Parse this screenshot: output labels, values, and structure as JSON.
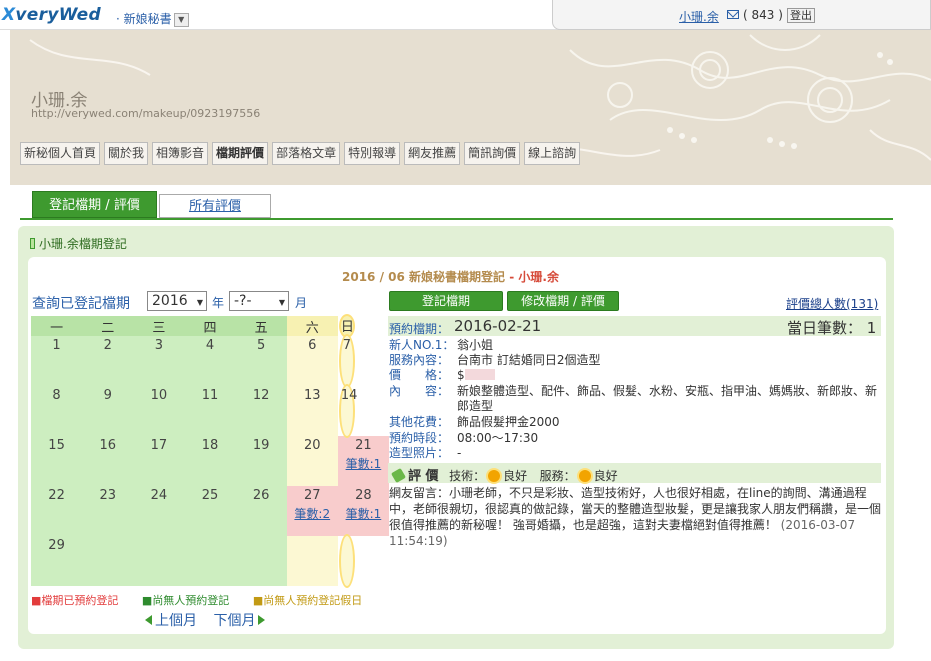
{
  "topbar": {
    "logo_x": "X",
    "logo_rest": "veryWed",
    "site_tag": "新娘秘書",
    "username": "小珊.余",
    "message_count": "( 843 )",
    "logout": "登出"
  },
  "profile": {
    "name": "小珊.余",
    "url": "http://verywed.com/makeup/0923197556"
  },
  "nav": {
    "items": [
      "新秘個人首頁",
      "關於我",
      "相簿影音",
      "檔期評價",
      "部落格文章",
      "特別報導",
      "網友推薦",
      "簡訊詢價",
      "線上諮詢"
    ],
    "active_index": 3
  },
  "tabs": {
    "register": "登記檔期 / 評價",
    "all_reviews": "所有評價"
  },
  "box_title": "小珊.余檔期登記",
  "calendar": {
    "heading_date": "2016 / 06",
    "heading_text": "新娘秘書檔期登記",
    "heading_sep": " - ",
    "heading_who": "小珊.余",
    "query_label": "查詢已登記檔期",
    "year": "2016",
    "year_label": "年",
    "month": "-?-",
    "month_label": "月",
    "weekdays": [
      "一",
      "二",
      "三",
      "四",
      "五",
      "六",
      "日"
    ],
    "weeks": [
      [
        {
          "d": "1"
        },
        {
          "d": "2"
        },
        {
          "d": "3"
        },
        {
          "d": "4"
        },
        {
          "d": "5"
        },
        {
          "d": "6"
        },
        {
          "d": "7"
        }
      ],
      [
        {
          "d": "8"
        },
        {
          "d": "9"
        },
        {
          "d": "10"
        },
        {
          "d": "11"
        },
        {
          "d": "12"
        },
        {
          "d": "13"
        },
        {
          "d": "14"
        }
      ],
      [
        {
          "d": "15"
        },
        {
          "d": "16"
        },
        {
          "d": "17"
        },
        {
          "d": "18"
        },
        {
          "d": "19"
        },
        {
          "d": "20"
        },
        {
          "d": "21",
          "count": "筆數:1"
        }
      ],
      [
        {
          "d": "22"
        },
        {
          "d": "23"
        },
        {
          "d": "24"
        },
        {
          "d": "25"
        },
        {
          "d": "26"
        },
        {
          "d": "27",
          "count": "筆數:2"
        },
        {
          "d": "28",
          "count": "筆數:1"
        }
      ],
      [
        {
          "d": "29"
        },
        {
          "d": ""
        },
        {
          "d": ""
        },
        {
          "d": ""
        },
        {
          "d": ""
        },
        {
          "d": ""
        },
        {
          "d": ""
        }
      ]
    ],
    "legend": {
      "booked": "檔期已預約登記",
      "free": "尚無人預約登記",
      "free_holiday": "尚無人預約登記假日"
    },
    "prev": "上個月",
    "next": "下個月"
  },
  "detail": {
    "register_button": "登記檔期",
    "edit_button": "修改檔期 / 評價",
    "review_total": "評價總人數(131)",
    "booking_label": "預約檔期：",
    "booking_date": "2016-02-21",
    "daily_count": "當日筆數： 1",
    "rows": [
      {
        "k": "新人NO.1：",
        "v": "翁小姐"
      },
      {
        "k": "服務內容：",
        "v": "台南市 訂結婚同日2個造型"
      },
      {
        "k": "價　　格：",
        "v": "$"
      },
      {
        "k": "內　　容：",
        "v": "新娘整體造型、配件、飾品、假髮、水粉、安瓶、指甲油、媽媽妝、新郎妝、新郎造型"
      },
      {
        "k": "其他花費：",
        "v": "飾品假髮押金2000"
      },
      {
        "k": "預約時段：",
        "v": "08:00～17:30"
      },
      {
        "k": "造型照片：",
        "v": "-"
      }
    ],
    "eval_label": "評 價",
    "tech_label": "技術：",
    "tech_value": "良好",
    "service_label": "服務：",
    "service_value": "良好",
    "comment": "網友留言：小珊老師，不只是彩妝、造型技術好，人也很好相處，在line的詢問、溝通過程中，老師很親切，很認真的做記錄，當天的整體造型妝髮，更是讓我家人朋友們稱讚，是一個很值得推薦的新秘喔！ 強哥婚攝，也是超強，這對夫妻檔絕對值得推薦！",
    "comment_time": "(2016-03-07 11:54:19)"
  },
  "colors": {
    "green": "#3e9a2f",
    "booked": "#f8cccc",
    "weekday": "#cdeec0",
    "weekend": "#fcf8d3"
  }
}
